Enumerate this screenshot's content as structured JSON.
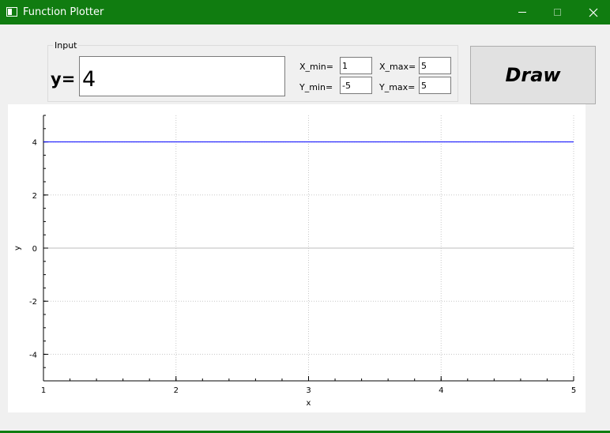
{
  "window": {
    "title": "Function Plotter",
    "accent_color": "#107c10",
    "icons": {
      "app": "app-window-icon",
      "minimize": "minimize-icon",
      "maximize": "maximize-icon",
      "close": "close-icon"
    }
  },
  "input_group": {
    "title": "Input",
    "y_label": "y=",
    "function_value": "4",
    "x_min_label": "X_min=",
    "x_min_value": "1",
    "x_max_label": "X_max=",
    "x_max_value": "5",
    "y_min_label": "Y_min=",
    "y_min_value": "-5",
    "y_max_label": "Y_max=",
    "y_max_value": "5"
  },
  "draw_button": {
    "label": "Draw"
  },
  "chart_data": {
    "type": "line",
    "title": "",
    "xlabel": "x",
    "ylabel": "y",
    "xlim": [
      1,
      5
    ],
    "ylim": [
      -5,
      5
    ],
    "x_ticks": [
      1,
      2,
      3,
      4,
      5
    ],
    "x_tick_labels": [
      "1",
      "2",
      "3",
      "4",
      "5"
    ],
    "y_ticks": [
      -4,
      -2,
      0,
      2,
      4
    ],
    "y_tick_labels": [
      "-4",
      "-2",
      "0",
      "2",
      "4"
    ],
    "grid": true,
    "series": [
      {
        "x": [
          1,
          5
        ],
        "y": [
          4,
          4
        ],
        "color": "#0000ff"
      }
    ]
  }
}
